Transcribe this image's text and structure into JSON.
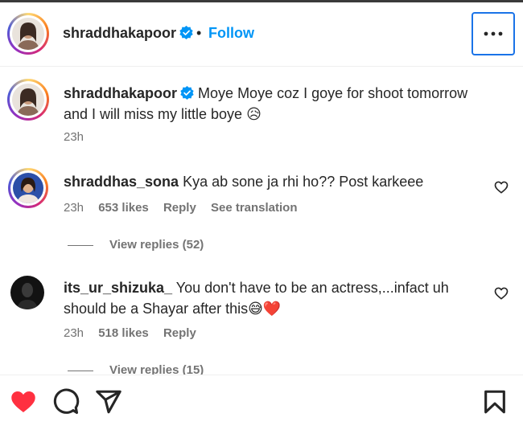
{
  "header": {
    "username": "shraddhakapoor",
    "dot": "•",
    "follow_label": "Follow"
  },
  "caption": {
    "username": "shraddhakapoor",
    "line1": "Moye Moye coz I goye for shoot tomorrow",
    "line2": "and I will miss my little boye 😥",
    "time": "23h"
  },
  "comments": [
    {
      "username": "shraddhas_sona",
      "text": "Kya ab sone ja rhi ho?? Post karkeee",
      "time": "23h",
      "likes": "653 likes",
      "reply_label": "Reply",
      "translation_label": "See translation",
      "view_replies": "View replies (52)"
    },
    {
      "username": "its_ur_shizuka_",
      "text": "You don't have to be an actress,...infact uh",
      "text2": "should be a Shayar after this😅❤️",
      "time": "23h",
      "likes": "518 likes",
      "reply_label": "Reply",
      "view_replies": "View replies (15)"
    }
  ],
  "colors": {
    "follow": "#0095f6",
    "like_active": "#ff3040",
    "focus_outline": "#1a73e8"
  },
  "icons": {
    "more": "more-options-icon",
    "like": "heart-filled-icon",
    "comment": "comment-bubble-icon",
    "share": "share-paper-plane-icon",
    "save": "bookmark-icon"
  }
}
